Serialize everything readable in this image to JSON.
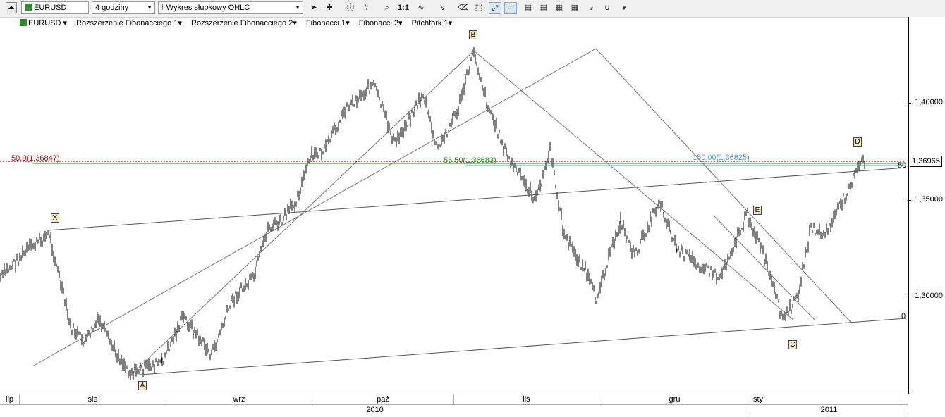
{
  "toolbar": {
    "symbol": "EURUSD",
    "timeframe": "4 godziny",
    "chart_type": "Wykres słupkowy OHLC",
    "zoom_label": "1:1"
  },
  "indicators": [
    {
      "label": "EURUSD"
    },
    {
      "label": "Rozszerzenie Fibonacciego 1"
    },
    {
      "label": "Rozszerzenie Fibonacciego 2"
    },
    {
      "label": "Fibonacci 1"
    },
    {
      "label": "Fibonacci 2"
    },
    {
      "label": "Pitchfork 1"
    }
  ],
  "price_axis": {
    "ticks": [
      "1,40000",
      "1,35000",
      "1,30000"
    ],
    "current_price": "1,36965"
  },
  "chart_labels": {
    "fib_red_left": "50,0(1,36847)",
    "fib_green": "56,50(1,36683)",
    "fib_blue": "150,00(1,36825)",
    "right_50": "50",
    "right_0": "0"
  },
  "wave_labels": [
    "X",
    "A",
    "B",
    "C",
    "D",
    "E"
  ],
  "time_axis": {
    "months": [
      "lip",
      "sie",
      "wrz",
      "paź",
      "lis",
      "gru",
      "sty"
    ],
    "years": [
      "2010",
      "2011"
    ]
  },
  "colors": {
    "fib_red": "#c00000",
    "fib_green": "#1f8a1f",
    "fib_blue": "#5a9ad6",
    "bars": "#000000",
    "lines": "#555555",
    "label_bg": "#f8e6c6"
  },
  "icons": [
    "cursor-icon",
    "crosshair-icon",
    "info-icon",
    "grid-icon",
    "zoom-icon",
    "indicator-icon",
    "line-tool-icon",
    "eraser-icon",
    "object-icon",
    "move-icon",
    "fib-icon",
    "template-icon",
    "alert-icon",
    "magnet-icon"
  ]
}
